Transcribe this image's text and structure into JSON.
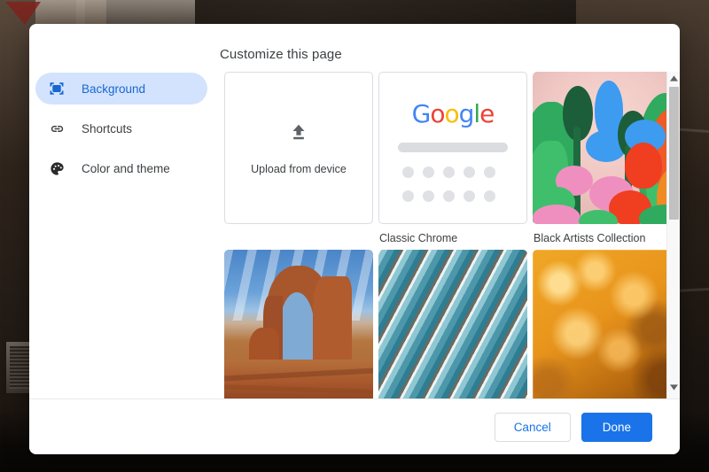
{
  "backdrop": {
    "description": "dark street building photo"
  },
  "dialog": {
    "title": "Customize this page"
  },
  "sidebar": {
    "items": [
      {
        "label": "Background",
        "icon": "wallpaper-icon",
        "selected": true
      },
      {
        "label": "Shortcuts",
        "icon": "link-icon",
        "selected": false
      },
      {
        "label": "Color and theme",
        "icon": "palette-icon",
        "selected": false
      }
    ]
  },
  "content": {
    "tiles": [
      {
        "id": "upload",
        "label": "",
        "inner_text": "Upload from device",
        "icon": "upload-icon",
        "type": "action"
      },
      {
        "id": "classic-chrome",
        "label": "Classic Chrome",
        "type": "theme-preview",
        "logo": "Google"
      },
      {
        "id": "black-artists-collection",
        "label": "Black Artists Collection",
        "type": "image"
      },
      {
        "id": "landscapes",
        "label": "",
        "type": "image"
      },
      {
        "id": "architecture",
        "label": "",
        "type": "image"
      },
      {
        "id": "textures",
        "label": "",
        "type": "image"
      }
    ],
    "google_logo_letters": [
      {
        "ch": "G",
        "color": "#4285f4"
      },
      {
        "ch": "o",
        "color": "#ea4335"
      },
      {
        "ch": "o",
        "color": "#fbbc05"
      },
      {
        "ch": "g",
        "color": "#4285f4"
      },
      {
        "ch": "l",
        "color": "#34a853"
      },
      {
        "ch": "e",
        "color": "#ea4335"
      }
    ]
  },
  "scrollbar": {
    "up_arrow": "scroll-up-arrow",
    "down_arrow": "scroll-down-arrow"
  },
  "footer": {
    "cancel_label": "Cancel",
    "done_label": "Done"
  },
  "colors": {
    "accent_blue": "#1a73e8",
    "selected_pill": "#d3e3fd",
    "selected_text": "#1967d2",
    "border": "#dadce0",
    "text": "#3c4043"
  }
}
